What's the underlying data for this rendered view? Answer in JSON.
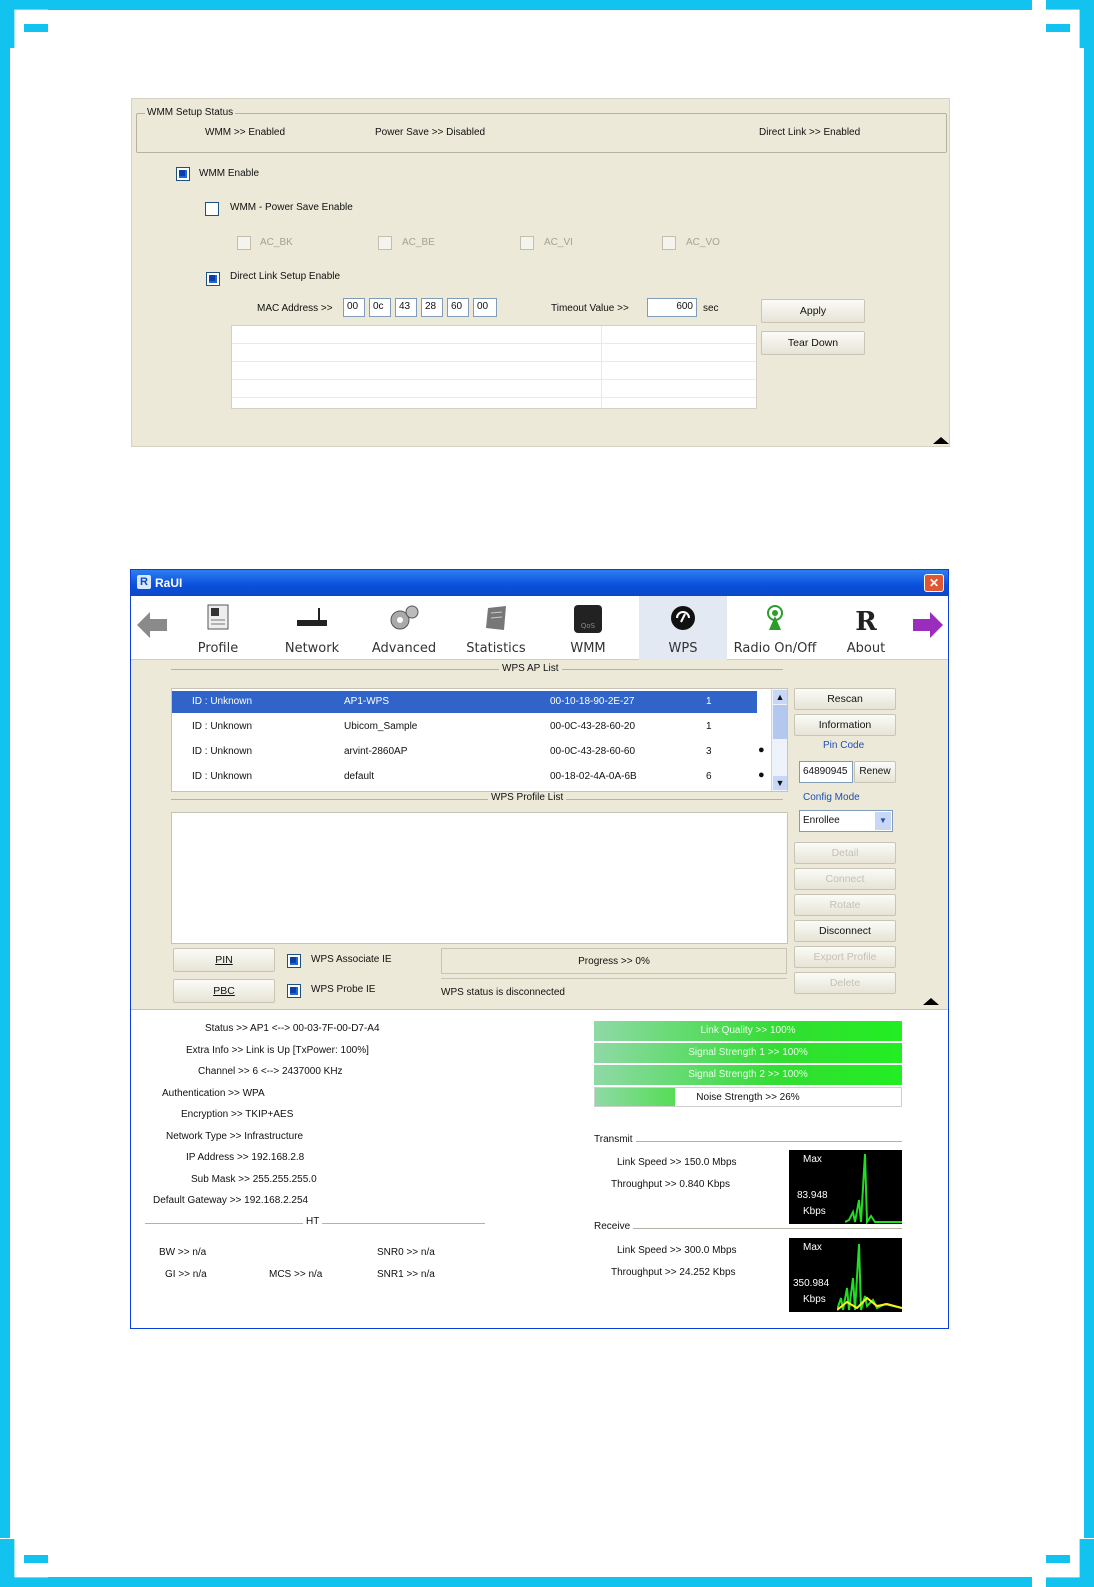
{
  "wmm_panel": {
    "status_group_title": "WMM Setup Status",
    "status_wmm": "WMM >> Enabled",
    "status_power_save": "Power Save >> Disabled",
    "status_direct_link": "Direct Link >> Enabled",
    "wmm_enable_label": "WMM Enable",
    "power_save_label": "WMM - Power Save Enable",
    "ac_bk": "AC_BK",
    "ac_be": "AC_BE",
    "ac_vi": "AC_VI",
    "ac_vo": "AC_VO",
    "dls_label": "Direct Link Setup Enable",
    "mac_label": "MAC Address >>",
    "mac": [
      "00",
      "0c",
      "43",
      "28",
      "60",
      "00"
    ],
    "timeout_label": "Timeout Value >>",
    "timeout_value": "600",
    "timeout_unit": "sec",
    "apply": "Apply",
    "tear_down": "Tear Down"
  },
  "raui": {
    "title": "RaUI",
    "close": "✕",
    "toolbar": {
      "profile": "Profile",
      "network": "Network",
      "advanced": "Advanced",
      "statistics": "Statistics",
      "wmm": "WMM",
      "wps": "WPS",
      "radio": "Radio On/Off",
      "about": "About"
    },
    "wps_ap_list_title": "WPS AP List",
    "ap_list": [
      {
        "id": "ID : Unknown",
        "ssid": "AP1-WPS",
        "mac": "00-10-18-90-2E-27",
        "ch": "1"
      },
      {
        "id": "ID : Unknown",
        "ssid": "Ubicom_Sample",
        "mac": "00-0C-43-28-60-20",
        "ch": "1"
      },
      {
        "id": "ID : Unknown",
        "ssid": "arvint-2860AP",
        "mac": "00-0C-43-28-60-60",
        "ch": "3"
      },
      {
        "id": "ID : Unknown",
        "ssid": "default",
        "mac": "00-18-02-4A-0A-6B",
        "ch": "6"
      }
    ],
    "wps_profile_list_title": "WPS Profile List",
    "buttons": {
      "rescan": "Rescan",
      "information": "Information",
      "pin_code_label": "Pin Code",
      "pin_code": "64890945",
      "renew": "Renew",
      "config_mode_label": "Config Mode",
      "config_mode": "Enrollee",
      "detail": "Detail",
      "connect": "Connect",
      "rotate": "Rotate",
      "disconnect": "Disconnect",
      "export_profile": "Export Profile",
      "delete": "Delete",
      "pin": "PIN",
      "pbc": "PBC"
    },
    "wps_associate_ie": "WPS Associate IE",
    "wps_probe_ie": "WPS Probe IE",
    "progress": "Progress >> 0%",
    "wps_status": "WPS status is disconnected",
    "status": {
      "status": "Status >> AP1 <--> 00-03-7F-00-D7-A4",
      "extra_info": "Extra Info >> Link is Up [TxPower: 100%]",
      "channel": "Channel >> 6 <--> 2437000 KHz",
      "authentication": "Authentication >> WPA",
      "encryption": "Encryption >> TKIP+AES",
      "network_type": "Network Type >> Infrastructure",
      "ip": "IP Address >> 192.168.2.8",
      "subnet": "Sub Mask >> 255.255.255.0",
      "gateway": "Default Gateway >> 192.168.2.254"
    },
    "ht_title": "HT",
    "ht": {
      "bw": "BW >> n/a",
      "gi": "GI >> n/a",
      "mcs": "MCS >> n/a",
      "snr0": "SNR0 >> n/a",
      "snr1": "SNR1 >> n/a"
    },
    "bars": {
      "link_quality": "Link Quality >> 100%",
      "signal1": "Signal Strength 1 >> 100%",
      "signal2": "Signal Strength 2 >> 100%",
      "noise": "Noise Strength >> 26%",
      "noise_fraction": 0.26
    },
    "transmit_title": "Transmit",
    "transmit_link_speed": "Link Speed >> 150.0 Mbps",
    "transmit_throughput": "Throughput >> 0.840 Kbps",
    "transmit_graph_max": "Max",
    "transmit_graph_value": "83.948",
    "transmit_graph_unit": "Kbps",
    "receive_title": "Receive",
    "receive_link_speed": "Link Speed >> 300.0 Mbps",
    "receive_throughput": "Throughput >> 24.252 Kbps",
    "receive_graph_max": "Max",
    "receive_graph_value": "350.984",
    "receive_graph_unit": "Kbps",
    "colors": {
      "title_bar": "#0a4fdb",
      "selected_row": "#3164c8",
      "bar_green": "#33cc33"
    }
  }
}
